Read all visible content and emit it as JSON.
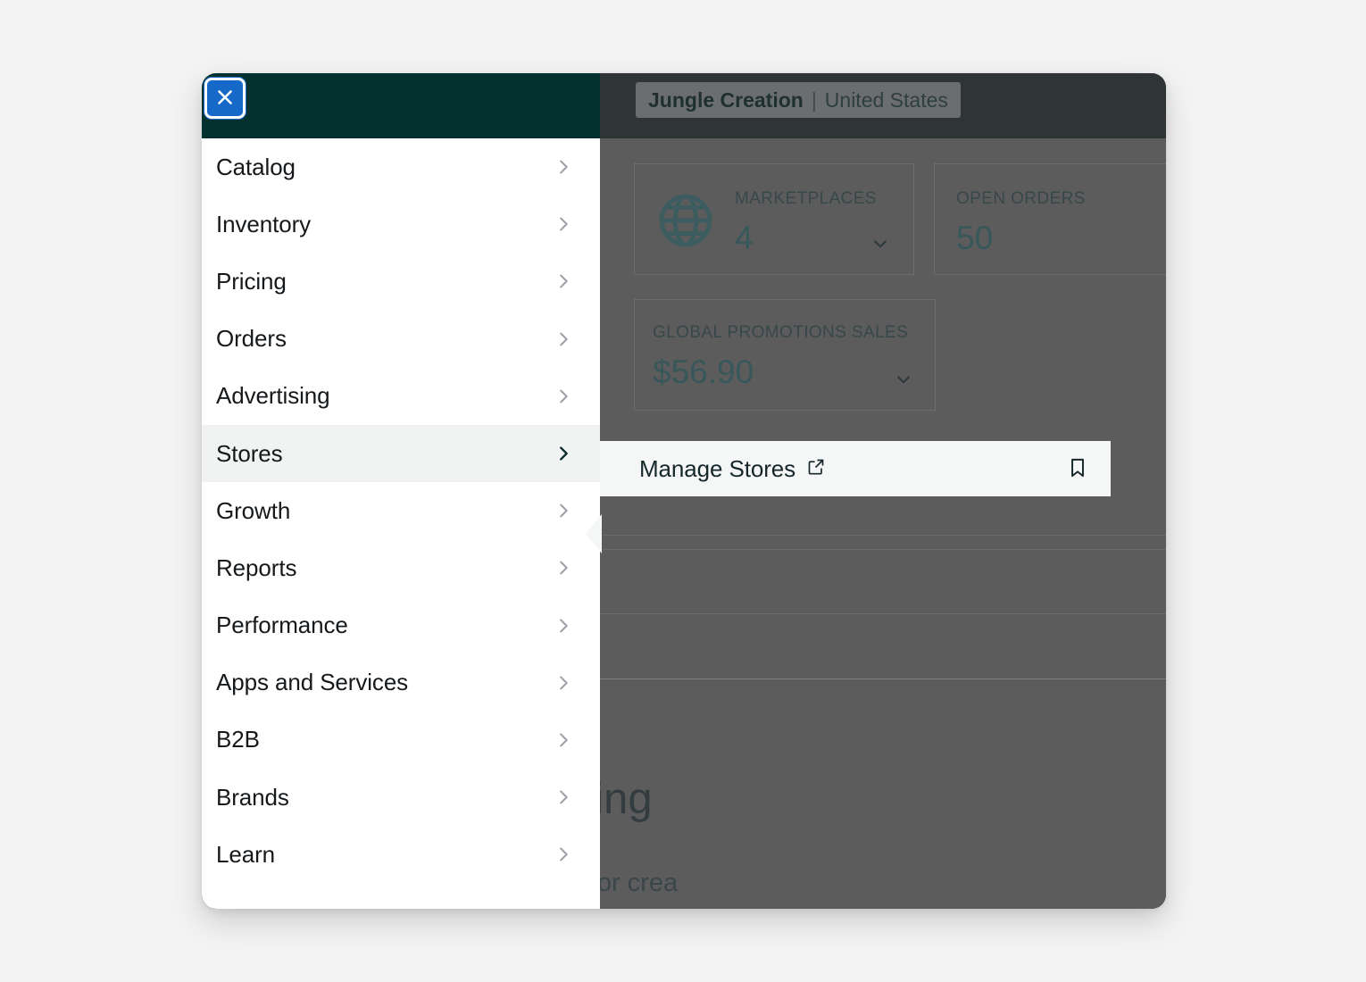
{
  "window": {
    "topbar": {
      "store_switcher": {
        "store_name": "Jungle Creation",
        "separator": "|",
        "country": "United States"
      }
    }
  },
  "dashboard": {
    "kpi_cards": [
      {
        "id": "marketplaces",
        "label": "MARKETPLACES",
        "value": "4",
        "icon": "globe-icon",
        "has_caret": true
      },
      {
        "id": "open-orders",
        "label": "OPEN ORDERS",
        "value": "50",
        "has_caret": false
      },
      {
        "id": "global-promotions-sales",
        "label": "GLOBAL PROMOTIONS SALES",
        "value": "$56.90",
        "has_caret": true
      }
    ],
    "background_text": {
      "heading": "h your first product listing",
      "subtitle": "eps you through all the requirements for crea"
    }
  },
  "nav_menu": {
    "close_label": "Close menu",
    "close_icon": "close-icon",
    "items": [
      {
        "label": "Catalog",
        "active": false
      },
      {
        "label": "Inventory",
        "active": false
      },
      {
        "label": "Pricing",
        "active": false
      },
      {
        "label": "Orders",
        "active": false
      },
      {
        "label": "Advertising",
        "active": false
      },
      {
        "label": "Stores",
        "active": true
      },
      {
        "label": "Growth",
        "active": false
      },
      {
        "label": "Reports",
        "active": false
      },
      {
        "label": "Performance",
        "active": false
      },
      {
        "label": "Apps and Services",
        "active": false
      },
      {
        "label": "B2B",
        "active": false
      },
      {
        "label": "Brands",
        "active": false
      },
      {
        "label": "Learn",
        "active": false
      }
    ]
  },
  "submenu": {
    "parent": "Stores",
    "item_label": "Manage Stores",
    "external_icon": "external-link-icon",
    "bookmark_icon": "bookmark-icon"
  },
  "colors": {
    "nav_header": "#02312f",
    "page_background": "#f2f3f2",
    "dim_topbar": "#2f3437",
    "dim_content": "#5c5c5c",
    "focus_ring": "#1769c9",
    "active_item_bg": "#f1f3f2",
    "kpi_value_text": "#37575a"
  }
}
